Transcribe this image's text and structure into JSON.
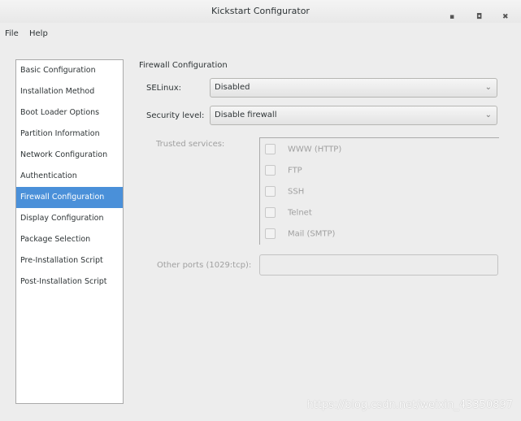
{
  "window": {
    "title": "Kickstart Configurator",
    "minimize": "▪",
    "maximize": "◘",
    "close": "✖"
  },
  "menu": [
    "File",
    "Help"
  ],
  "sidebar": {
    "items": [
      "Basic Configuration",
      "Installation Method",
      "Boot Loader Options",
      "Partition Information",
      "Network Configuration",
      "Authentication",
      "Firewall Configuration",
      "Display Configuration",
      "Package Selection",
      "Pre-Installation Script",
      "Post-Installation Script"
    ],
    "active": 6
  },
  "firewall": {
    "heading": "Firewall Configuration",
    "selinux_label": "SELinux:",
    "selinux_value": "Disabled",
    "security_label": "Security level:",
    "security_value": "Disable firewall",
    "trusted_label": "Trusted services:",
    "services": [
      {
        "label": "WWW (HTTP)",
        "checked": false
      },
      {
        "label": "FTP",
        "checked": false
      },
      {
        "label": "SSH",
        "checked": false
      },
      {
        "label": "Telnet",
        "checked": false
      },
      {
        "label": "Mail (SMTP)",
        "checked": false
      }
    ],
    "other_ports_label": "Other ports (1029:tcp):",
    "other_ports_value": ""
  },
  "watermark": "https://blog.csdn.net/weixin_43350897",
  "colors": {
    "accent": "#4a90d9"
  }
}
